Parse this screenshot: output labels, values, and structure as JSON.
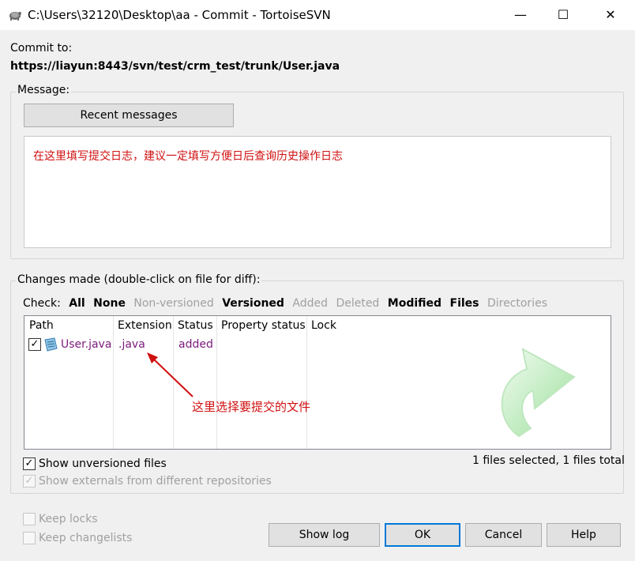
{
  "window": {
    "title": "C:\\Users\\32120\\Desktop\\aa - Commit - TortoiseSVN",
    "minimize": "—",
    "maximize": "☐",
    "close": "✕"
  },
  "commit_to": {
    "label": "Commit to:",
    "url": "https://liayun:8443/svn/test/crm_test/trunk/User.java"
  },
  "message": {
    "group_label": "Message:",
    "recent_button": "Recent messages",
    "text": "在这里填写提交日志，建议一定填写方便日后查询历史操作日志"
  },
  "changes": {
    "group_label": "Changes made (double-click on file for diff):",
    "check_label": "Check:",
    "filters": {
      "all": "All",
      "none": "None",
      "non_versioned": "Non-versioned",
      "versioned": "Versioned",
      "added": "Added",
      "deleted": "Deleted",
      "modified": "Modified",
      "files": "Files",
      "directories": "Directories"
    },
    "columns": {
      "path": "Path",
      "extension": "Extension",
      "status": "Status",
      "property_status": "Property status",
      "lock": "Lock"
    },
    "rows": [
      {
        "checked": true,
        "path": "User.java",
        "extension": ".java",
        "status": "added"
      }
    ],
    "annotation": "这里选择要提交的文件"
  },
  "options": {
    "show_unversioned": "Show unversioned files",
    "show_unversioned_checked": true,
    "show_externals": "Show externals from different repositories",
    "show_externals_checked": true,
    "keep_locks": "Keep locks",
    "keep_changelists": "Keep changelists",
    "files_summary": "1 files selected, 1 files total"
  },
  "buttons": {
    "show_log": "Show log",
    "ok": "OK",
    "cancel": "Cancel",
    "help": "Help"
  },
  "colors": {
    "accent": "#0078d7",
    "annotation": "#d01010",
    "svn_item": "#7a1a7a"
  }
}
